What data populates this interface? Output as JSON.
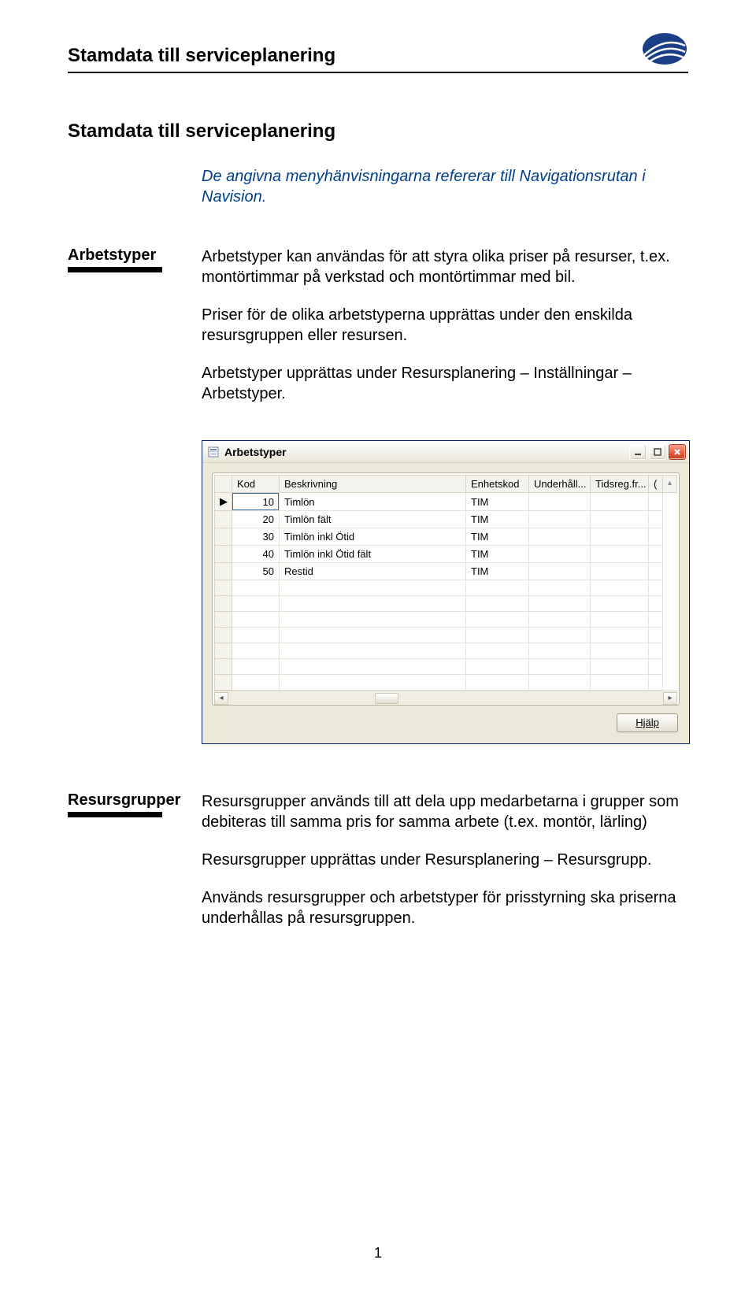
{
  "header": {
    "title": "Stamdata till serviceplanering"
  },
  "main_title": "Stamdata till serviceplanering",
  "intro": "De angivna menyhänvisningarna refererar till Navigationsrutan i Navision.",
  "sections": {
    "arbetstyper": {
      "label": "Arbetstyper",
      "p1": "Arbetstyper kan användas för att styra olika priser på resurser, t.ex. montörtimmar på verkstad och montörtimmar med bil.",
      "p2": "Priser för de olika arbetstyperna upprättas under den enskilda resursgruppen eller resursen.",
      "p3": "Arbetstyper upprättas under Resursplanering – Inställningar – Arbetstyper."
    },
    "resursgrupper": {
      "label": "Resursgrupper",
      "p1": "Resursgrupper används till att dela upp medarbetarna i grupper som debiteras till samma pris for samma arbete (t.ex. montör, lärling)",
      "p2": "Resursgrupper upprättas under Resursplanering – Resursgrupp.",
      "p3": "Används resursgrupper och arbetstyper för prisstyrning ska priserna underhållas på resursgruppen."
    }
  },
  "window": {
    "title": "Arbetstyper",
    "columns": {
      "kod": "Kod",
      "beskrivning": "Beskrivning",
      "enhetskod": "Enhetskod",
      "underhall": "Underhåll...",
      "tidsreg": "Tidsreg.fr...",
      "last": "("
    },
    "rows": [
      {
        "kod": "10",
        "beskrivning": "Timlön",
        "enhetskod": "TIM"
      },
      {
        "kod": "20",
        "beskrivning": "Timlön fält",
        "enhetskod": "TIM"
      },
      {
        "kod": "30",
        "beskrivning": "Timlön inkl Ötid",
        "enhetskod": "TIM"
      },
      {
        "kod": "40",
        "beskrivning": "Timlön inkl Ötid fält",
        "enhetskod": "TIM"
      },
      {
        "kod": "50",
        "beskrivning": "Restid",
        "enhetskod": "TIM"
      }
    ],
    "help_label": "Hjälp"
  },
  "page_number": "1"
}
